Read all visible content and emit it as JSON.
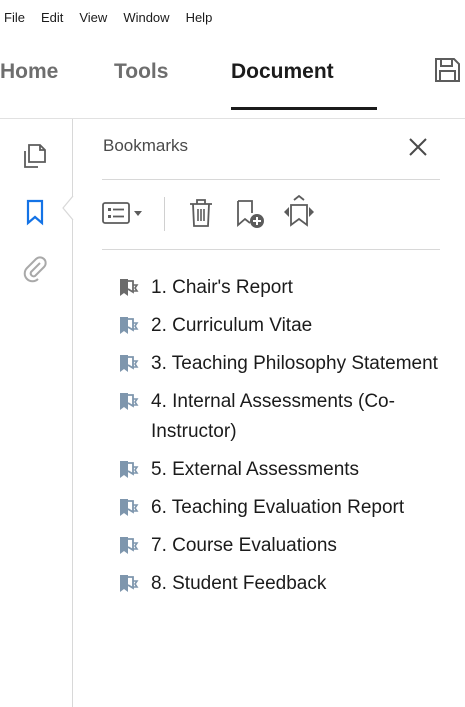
{
  "menu": {
    "items": [
      "File",
      "Edit",
      "View",
      "Window",
      "Help"
    ]
  },
  "tabs": {
    "home": "Home",
    "tools": "Tools",
    "document": "Document",
    "active": "Document"
  },
  "panel": {
    "title": "Bookmarks"
  },
  "bookmarks": [
    "1. Chair's Report",
    "2. Curriculum Vitae",
    "3. Teaching Philosophy Statement",
    "4. Internal Assessments (Co-Instructor)",
    "5. External Assessments",
    "6. Teaching Evaluation Report",
    "7. Course Evaluations",
    "8. Student Feedback"
  ],
  "colors": {
    "accent": "#1473e6",
    "text": "#1b1b1b",
    "muted": "#6e6e6e",
    "icon_gray": "#5c5c5c",
    "bookmark_active_icon": "#6b6b6b",
    "bookmark_icon": "#6f8fb0"
  },
  "icons": {
    "save": "save-icon",
    "pages": "pages-icon",
    "bookmarks": "bookmark-icon",
    "attachments": "paperclip-icon",
    "close": "close-icon",
    "options": "options-menu-icon",
    "delete": "trash-icon",
    "new_bookmark": "new-bookmark-icon",
    "expand": "expand-bookmark-icon"
  }
}
